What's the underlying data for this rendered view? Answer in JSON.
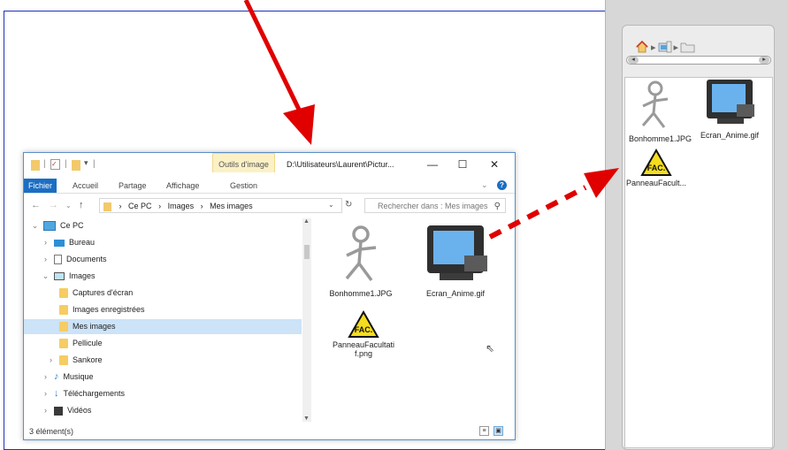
{
  "panel": {
    "path_segments": [
      "home-icon",
      "pc-icon",
      "folder-icon"
    ],
    "files": [
      {
        "name": "Bonhomme1.JPG",
        "icon": "stick-figure-icon"
      },
      {
        "name": "Ecran_Anime.gif",
        "icon": "monitor-icon"
      },
      {
        "name": "PanneauFacult...",
        "icon": "fac-sign-icon"
      }
    ]
  },
  "explorer": {
    "quick_access_icons": [
      "folder-icon",
      "checklist-icon",
      "folder-icon"
    ],
    "tools_tab": "Outils d'image",
    "title_path": "D:\\Utilisateurs\\Laurent\\Pictur...",
    "ribbon_tabs": [
      "Fichier",
      "Accueil",
      "Partage",
      "Affichage",
      "Gestion"
    ],
    "address": {
      "root": "Ce PC",
      "segments": [
        "Images",
        "Mes images"
      ]
    },
    "search_placeholder": "Rechercher dans : Mes images",
    "tree": [
      {
        "label": "Ce PC",
        "expanded": true
      },
      {
        "label": "Bureau"
      },
      {
        "label": "Documents"
      },
      {
        "label": "Images",
        "expanded": true
      },
      {
        "label": "Captures d'écran"
      },
      {
        "label": "Images enregistrées"
      },
      {
        "label": "Mes images",
        "selected": true
      },
      {
        "label": "Pellicule"
      },
      {
        "label": "Sankore"
      },
      {
        "label": "Musique"
      },
      {
        "label": "Téléchargements"
      },
      {
        "label": "Vidéos"
      }
    ],
    "files": [
      {
        "name": "Bonhomme1.JPG"
      },
      {
        "name": "Ecran_Anime.gif"
      },
      {
        "name_line1": "PanneauFacultati",
        "name_line2": "f.png"
      }
    ],
    "status": "3 élément(s)"
  },
  "colors": {
    "frame_blue": "#1f2fbf",
    "arrow_red": "#e00000",
    "ribbon_file": "#1b6ec3",
    "selection": "#cce3f8",
    "tools_tab": "#fbf1c5"
  }
}
